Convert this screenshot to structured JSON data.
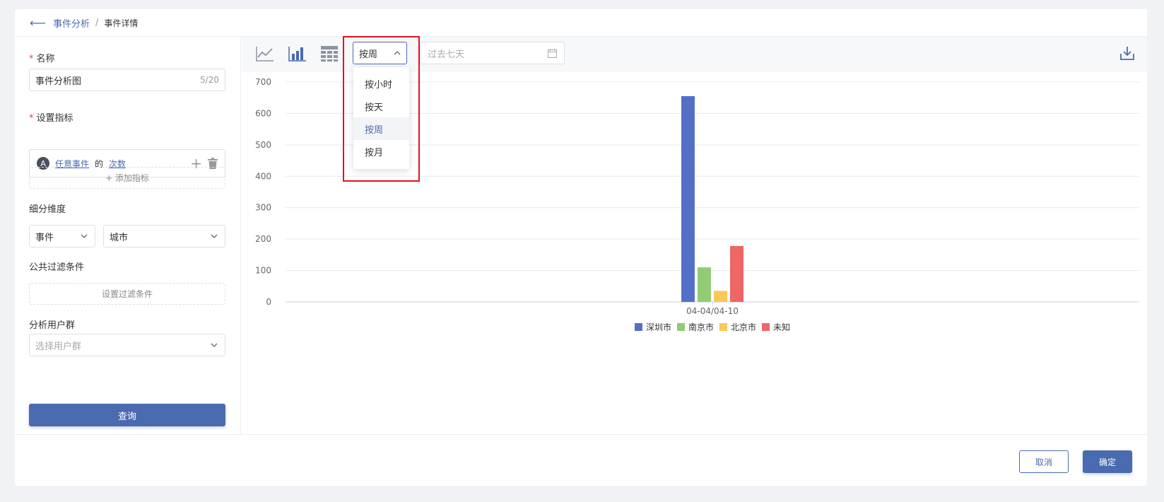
{
  "breadcrumb": {
    "parent": "事件分析",
    "separator": "/",
    "current": "事件详情"
  },
  "form": {
    "name_label": "名称",
    "name_value": "事件分析图",
    "name_counter": "5/20",
    "metric_label": "设置指标",
    "metric": {
      "badge": "A",
      "event": "任意事件",
      "of": "的",
      "measure": "次数"
    },
    "add_metric": "+ 添加指标",
    "dimension_label": "细分维度",
    "dimension_type": "事件",
    "dimension_value": "城市",
    "filter_label": "公共过滤条件",
    "filter_button": "设置过滤条件",
    "usergroup_label": "分析用户群",
    "usergroup_placeholder": "选择用户群",
    "query_button": "查询"
  },
  "toolbar": {
    "granularity": "按周",
    "date_placeholder": "过去七天",
    "icons": [
      "line-chart-icon",
      "bar-chart-icon",
      "table-icon",
      "download-icon"
    ]
  },
  "dropdown": {
    "options": [
      "按小时",
      "按天",
      "按周",
      "按月"
    ],
    "selected": "按周"
  },
  "footer": {
    "cancel": "取消",
    "confirm": "确定"
  },
  "colors": {
    "accent": "#4a6baf",
    "highlight": "#e8111e"
  },
  "chart_data": {
    "type": "bar",
    "categories": [
      "04-04/04-10"
    ],
    "series": [
      {
        "name": "深圳市",
        "values": [
          655
        ],
        "color": "#5470c6"
      },
      {
        "name": "南京市",
        "values": [
          110
        ],
        "color": "#91cc75"
      },
      {
        "name": "北京市",
        "values": [
          35
        ],
        "color": "#fac858"
      },
      {
        "name": "未知",
        "values": [
          178
        ],
        "color": "#ee6666"
      }
    ],
    "ylim": [
      0,
      700
    ],
    "yticks": [
      0,
      100,
      200,
      300,
      400,
      500,
      600,
      700
    ],
    "grid": true,
    "legend": "bottom"
  }
}
